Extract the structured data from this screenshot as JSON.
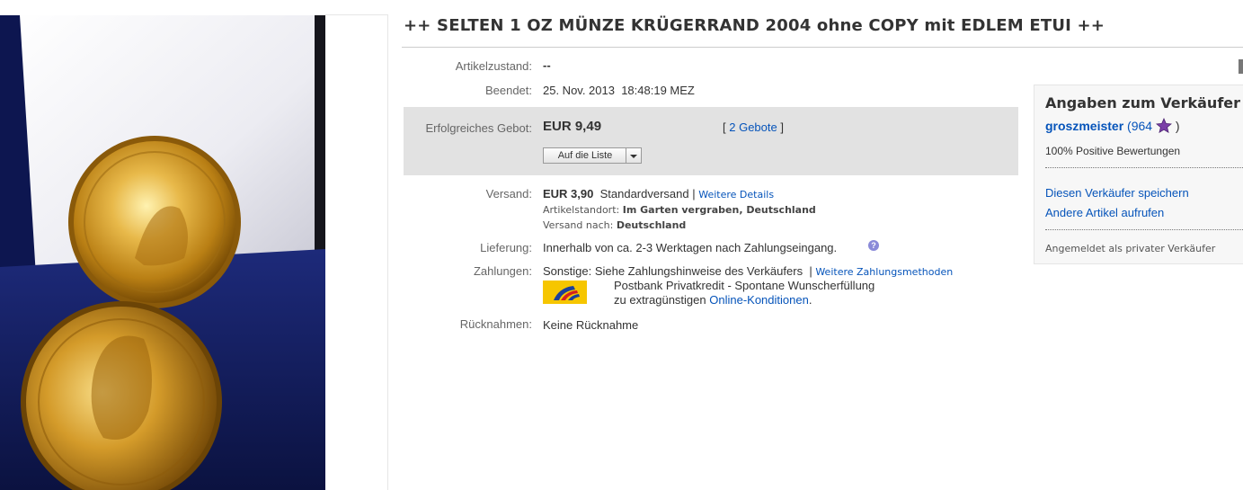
{
  "listing": {
    "title": "++ SELTEN 1 OZ MÜNZE KRÜGERRAND 2004 ohne COPY mit EDLEM ETUI ++"
  },
  "details": {
    "condition_label": "Artikelzustand:",
    "condition_value": "--",
    "ended_label": "Beendet:",
    "ended_value": "25. Nov. 2013  18:48:19 MEZ"
  },
  "bid": {
    "label": "Erfolgreiches Gebot:",
    "price": "EUR 9,49",
    "bids_open": "[ ",
    "bids_link": "2 Gebote",
    "bids_close": " ]",
    "watch_button": "Auf die Liste"
  },
  "shipping": {
    "label": "Versand:",
    "cost": "EUR 3,90",
    "method": "Standardversand | ",
    "details_link": "Weitere Details",
    "location_label": "Artikelstandort: ",
    "location_value": "Im Garten vergraben, Deutschland",
    "ships_to_label": "Versand nach: ",
    "ships_to_value": "Deutschland"
  },
  "delivery": {
    "label": "Lieferung:",
    "value": "Innerhalb von ca. 2-3 Werktagen nach Zahlungseingang.",
    "help_icon": "?"
  },
  "payment": {
    "label": "Zahlungen:",
    "value": "Sonstige: Siehe Zahlungshinweise des Verkäufers",
    "sep": "|",
    "more_link": "Weitere Zahlungsmethoden",
    "promo_line1": "Postbank Privatkredit - Spontane Wunscherfüllung",
    "promo_line2": "zu extragünstigen ",
    "promo_link": "Online-Konditionen",
    "promo_end": "."
  },
  "returns": {
    "label": "Rücknahmen:",
    "value": "Keine Rücknahme"
  },
  "seller": {
    "heading": "Angaben zum Verkäufer",
    "name": "groszmeister",
    "score_open": " (964 ",
    "score_close": " )",
    "feedback": "100% Positive Bewertungen",
    "save_link": "Diesen Verkäufer speichern",
    "other_link": "Andere Artikel aufrufen",
    "account_type": "Angemeldet als privater Verkäufer",
    "star_color": "#7b3fa8"
  },
  "icons": {
    "star": "star-icon",
    "help": "help-icon",
    "postbank": "postbank-logo",
    "dropdown": "chevron-down-icon"
  }
}
